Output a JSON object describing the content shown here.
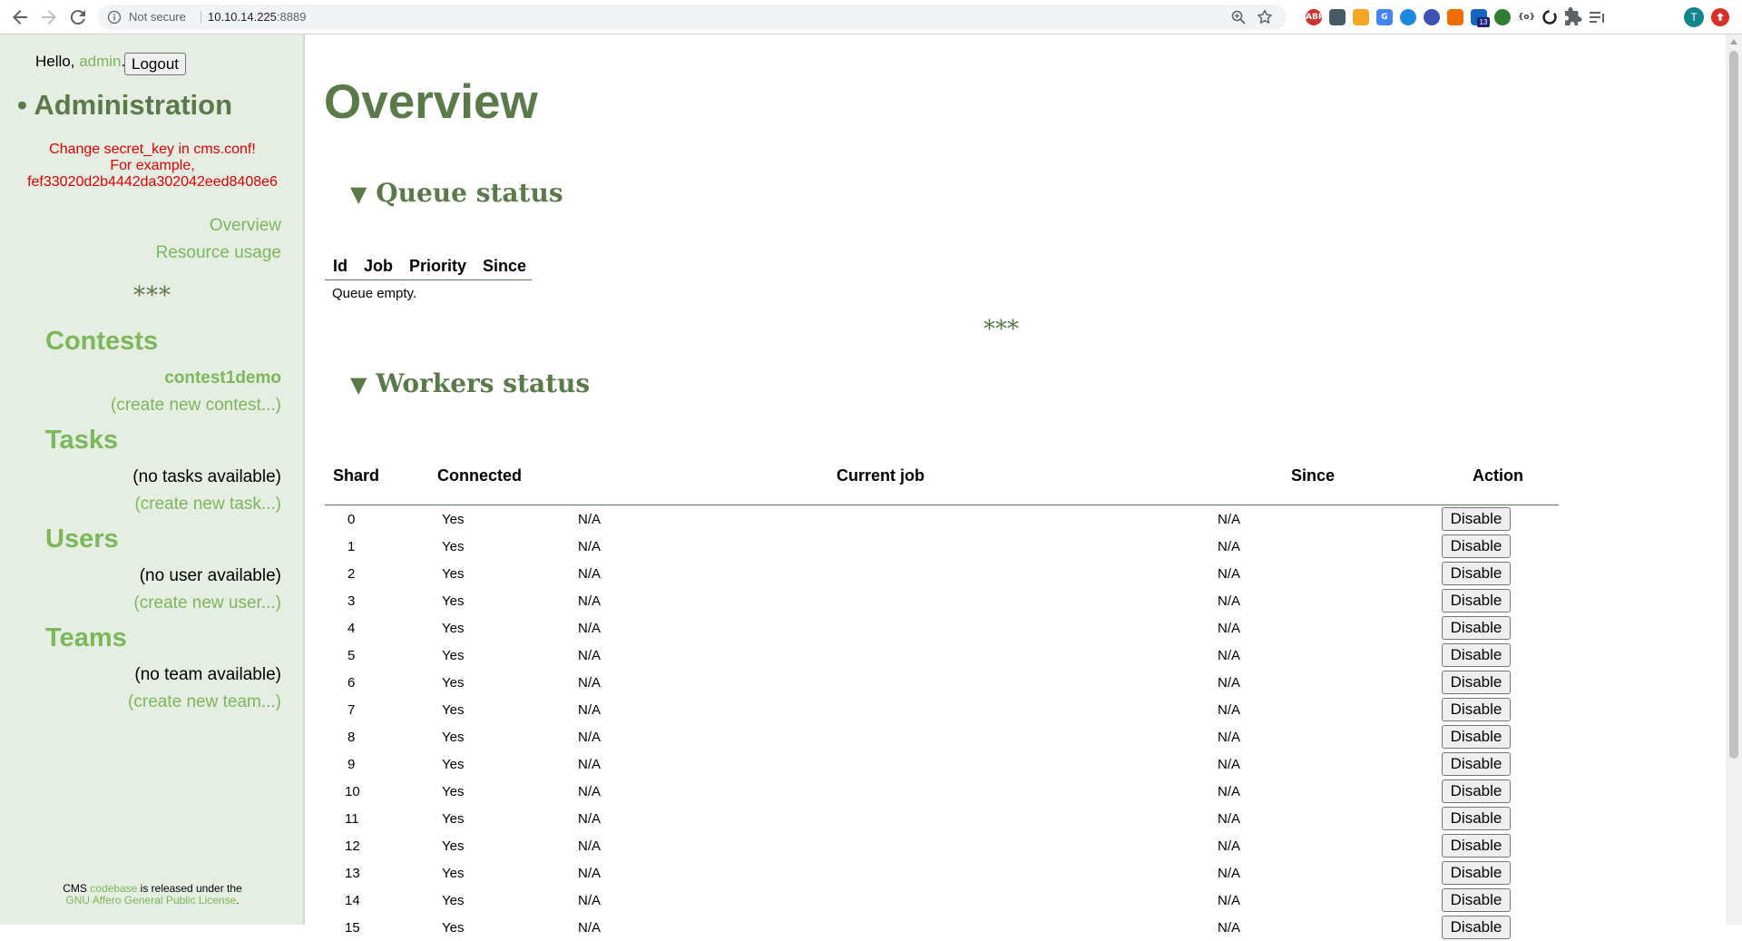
{
  "browser": {
    "security_label": "Not secure",
    "url_host": "10.10.14.225",
    "url_port": ":8889",
    "extension_badge": "13",
    "profile_initial": "T",
    "extensions": [
      {
        "name": "adblock-icon",
        "label": "ABP",
        "color": "#d32f2f"
      },
      {
        "name": "shield-extension-icon",
        "label": "",
        "color": "#455a64"
      },
      {
        "name": "orange-extension-icon",
        "label": "",
        "color": "#f5a623"
      },
      {
        "name": "translate-icon",
        "label": "G",
        "color": "#4285f4"
      },
      {
        "name": "pen-extension-icon",
        "label": "",
        "color": "#1e88e5"
      },
      {
        "name": "check-extension-icon",
        "label": "",
        "color": "#3f51b5"
      },
      {
        "name": "network-extension-icon",
        "label": "",
        "color": "#ef6c00"
      },
      {
        "name": "home-extension-icon",
        "label": "",
        "color": "#1565c0"
      },
      {
        "name": "moon-extension-icon",
        "label": "",
        "color": "#2e7d32"
      },
      {
        "name": "braces-extension-icon",
        "label": "{o}",
        "color": "#616161"
      },
      {
        "name": "sync-extension-icon",
        "label": "",
        "color": "#212121"
      },
      {
        "name": "puzzle-icon",
        "label": "",
        "color": "#5f6368"
      },
      {
        "name": "reading-list-icon",
        "label": "",
        "color": "#5f6368"
      }
    ]
  },
  "sidebar": {
    "greeting_prefix": "Hello, ",
    "user_name": "admin",
    "greeting_suffix": ".",
    "logout_label": "Logout",
    "admin_title": "• Administration",
    "warning_line1": "Change secret_key in cms.conf!",
    "warning_line2": "For example,",
    "warning_line3": "fef33020d2b4442da302042eed8408e6",
    "nav_overview": "Overview",
    "nav_resource_usage": "Resource usage",
    "separator": "***",
    "contests_title": "Contests",
    "contest_item": "contest1demo",
    "create_contest": "(create new contest...)",
    "tasks_title": "Tasks",
    "tasks_empty": "(no tasks available)",
    "create_task": "(create new task...)",
    "users_title": "Users",
    "users_empty": "(no user available)",
    "create_user": "(create new user...)",
    "teams_title": "Teams",
    "teams_empty": "(no team available)",
    "create_team": "(create new team...)",
    "footer_prefix": "CMS ",
    "footer_codebase": "codebase",
    "footer_middle": " is released under the",
    "footer_license": "GNU Affero General Public License",
    "footer_suffix": "."
  },
  "main": {
    "page_title": "Overview",
    "queue_title": "Queue status",
    "queue_columns": [
      "Id",
      "Job",
      "Priority",
      "Since"
    ],
    "queue_empty": "Queue empty.",
    "separator": "***",
    "workers_title": "Workers status",
    "workers_columns": {
      "shard": "Shard",
      "connected": "Connected",
      "current_job": "Current job",
      "since": "Since",
      "action": "Action"
    },
    "workers": [
      {
        "shard": "0",
        "connected": "Yes",
        "job": "N/A",
        "since": "N/A",
        "action": "Disable"
      },
      {
        "shard": "1",
        "connected": "Yes",
        "job": "N/A",
        "since": "N/A",
        "action": "Disable"
      },
      {
        "shard": "2",
        "connected": "Yes",
        "job": "N/A",
        "since": "N/A",
        "action": "Disable"
      },
      {
        "shard": "3",
        "connected": "Yes",
        "job": "N/A",
        "since": "N/A",
        "action": "Disable"
      },
      {
        "shard": "4",
        "connected": "Yes",
        "job": "N/A",
        "since": "N/A",
        "action": "Disable"
      },
      {
        "shard": "5",
        "connected": "Yes",
        "job": "N/A",
        "since": "N/A",
        "action": "Disable"
      },
      {
        "shard": "6",
        "connected": "Yes",
        "job": "N/A",
        "since": "N/A",
        "action": "Disable"
      },
      {
        "shard": "7",
        "connected": "Yes",
        "job": "N/A",
        "since": "N/A",
        "action": "Disable"
      },
      {
        "shard": "8",
        "connected": "Yes",
        "job": "N/A",
        "since": "N/A",
        "action": "Disable"
      },
      {
        "shard": "9",
        "connected": "Yes",
        "job": "N/A",
        "since": "N/A",
        "action": "Disable"
      },
      {
        "shard": "10",
        "connected": "Yes",
        "job": "N/A",
        "since": "N/A",
        "action": "Disable"
      },
      {
        "shard": "11",
        "connected": "Yes",
        "job": "N/A",
        "since": "N/A",
        "action": "Disable"
      },
      {
        "shard": "12",
        "connected": "Yes",
        "job": "N/A",
        "since": "N/A",
        "action": "Disable"
      },
      {
        "shard": "13",
        "connected": "Yes",
        "job": "N/A",
        "since": "N/A",
        "action": "Disable"
      },
      {
        "shard": "14",
        "connected": "Yes",
        "job": "N/A",
        "since": "N/A",
        "action": "Disable"
      },
      {
        "shard": "15",
        "connected": "Yes",
        "job": "N/A",
        "since": "N/A",
        "action": "Disable"
      }
    ]
  }
}
